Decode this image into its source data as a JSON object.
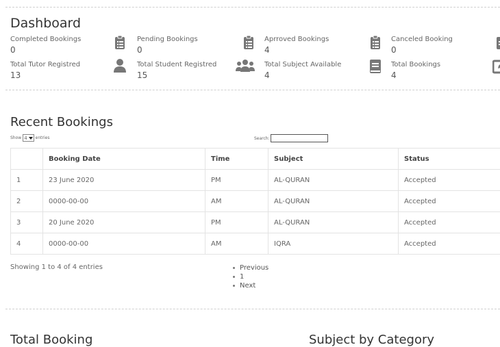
{
  "dashboard": {
    "title": "Dashboard",
    "stats": [
      {
        "label": "Completed Bookings",
        "value": "0",
        "icon": "clipboard-list-icon"
      },
      {
        "label": "Pending Bookings",
        "value": "0",
        "icon": "clipboard-list-icon"
      },
      {
        "label": "Aprroved Bookings",
        "value": "4",
        "icon": "clipboard-list-icon"
      },
      {
        "label": "Canceled Booking",
        "value": "0",
        "icon": "clipboard-list-icon"
      },
      {
        "label": "Total Tutor Registred",
        "value": "13",
        "icon": "user-icon"
      },
      {
        "label": "Total Student Registred",
        "value": "15",
        "icon": "users-icon"
      },
      {
        "label": "Total Subject Available",
        "value": "4",
        "icon": "book-icon"
      },
      {
        "label": "Total Bookings",
        "value": "4",
        "icon": "edit-icon"
      }
    ]
  },
  "recent": {
    "title": "Recent Bookings",
    "show_label": "Show",
    "entries_value": "4",
    "entries_label": "entries",
    "search_label": "Search:",
    "columns": [
      "",
      "Booking Date",
      "Time",
      "Subject",
      "Status"
    ],
    "rows": [
      [
        "1",
        "23 June 2020",
        "PM",
        "AL-QURAN",
        "Accepted"
      ],
      [
        "2",
        "0000-00-00",
        "AM",
        "AL-QURAN",
        "Accepted"
      ],
      [
        "3",
        "20 June 2020",
        "PM",
        "AL-QURAN",
        "Accepted"
      ],
      [
        "4",
        "0000-00-00",
        "AM",
        "IQRA",
        "Accepted"
      ]
    ],
    "info": "Showing 1 to 4 of 4 entries",
    "pagination": [
      "Previous",
      "1",
      "Next"
    ]
  },
  "charts": {
    "total_booking_title": "Total Booking",
    "subject_category_title": "Subject by Category"
  }
}
